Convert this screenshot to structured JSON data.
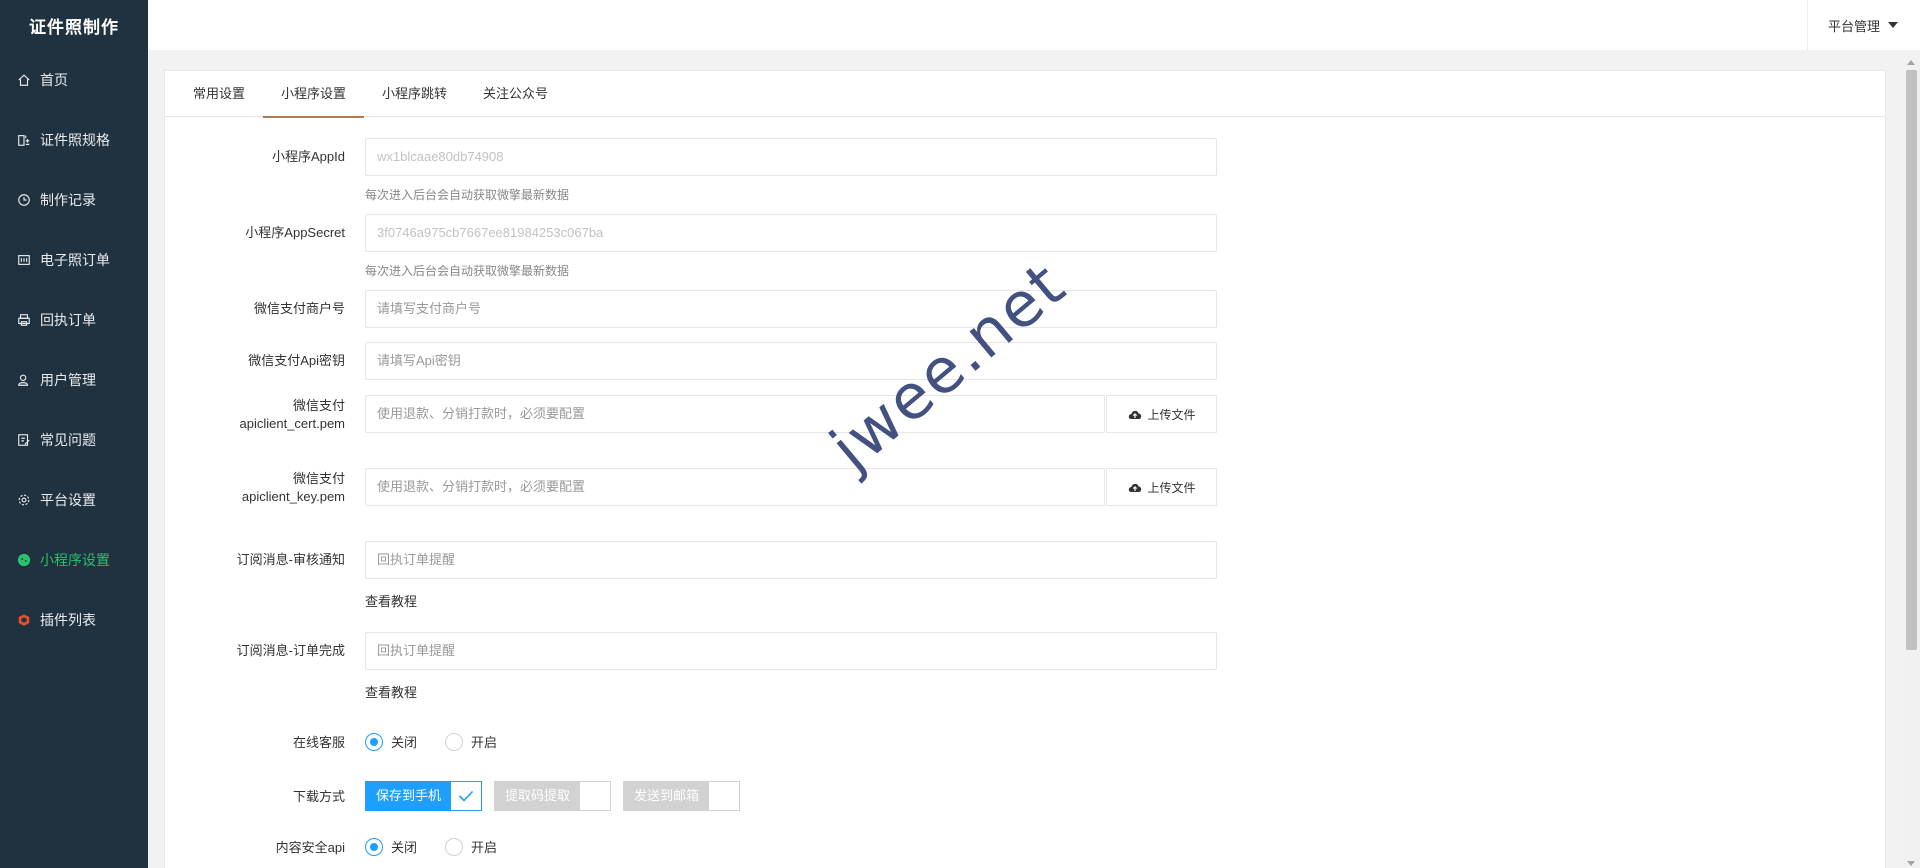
{
  "app": {
    "title": "证件照制作"
  },
  "sidebar": {
    "items": [
      {
        "label": "首页",
        "icon": "home-icon"
      },
      {
        "label": "证件照规格",
        "icon": "spec-icon"
      },
      {
        "label": "制作记录",
        "icon": "clock-icon"
      },
      {
        "label": "电子照订单",
        "icon": "grid-icon"
      },
      {
        "label": "回执订单",
        "icon": "printer-icon"
      },
      {
        "label": "用户管理",
        "icon": "user-icon"
      },
      {
        "label": "常见问题",
        "icon": "edit-icon"
      },
      {
        "label": "平台设置",
        "icon": "gear-icon"
      },
      {
        "label": "小程序设置",
        "icon": "wechat-icon",
        "active": true
      },
      {
        "label": "插件列表",
        "icon": "plugin-icon"
      }
    ],
    "active_color": "#2ac06d"
  },
  "header": {
    "platform_menu": "平台管理"
  },
  "tabs": [
    {
      "label": "常用设置"
    },
    {
      "label": "小程序设置",
      "active": true
    },
    {
      "label": "小程序跳转"
    },
    {
      "label": "关注公众号"
    }
  ],
  "form": {
    "appid": {
      "label": "小程序AppId",
      "value": "wx1blcaae80db74908",
      "hint": "每次进入后台会自动获取微擎最新数据"
    },
    "appsecret": {
      "label": "小程序AppSecret",
      "value": "3f0746a975cb7667ee81984253c067ba",
      "hint": "每次进入后台会自动获取微擎最新数据"
    },
    "mch_id": {
      "label": "微信支付商户号",
      "placeholder": "请填写支付商户号"
    },
    "api_key": {
      "label": "微信支付Api密钥",
      "placeholder": "请填写Api密钥"
    },
    "cert": {
      "label_line1": "微信支付",
      "label_line2": "apiclient_cert.pem",
      "placeholder": "使用退款、分销打款时，必须要配置",
      "button": "上传文件"
    },
    "key": {
      "label_line1": "微信支付",
      "label_line2": "apiclient_key.pem",
      "placeholder": "使用退款、分销打款时，必须要配置",
      "button": "上传文件"
    },
    "sub_audit": {
      "label": "订阅消息-审核通知",
      "placeholder": "回执订单提醒",
      "link": "查看教程"
    },
    "sub_done": {
      "label": "订阅消息-订单完成",
      "placeholder": "回执订单提醒",
      "link": "查看教程"
    },
    "online_service": {
      "label": "在线客服",
      "options": [
        "关闭",
        "开启"
      ],
      "selected": "关闭"
    },
    "download": {
      "label": "下载方式",
      "options": [
        {
          "label": "保存到手机",
          "checked": true
        },
        {
          "label": "提取码提取",
          "checked": false
        },
        {
          "label": "发送到邮箱",
          "checked": false
        }
      ]
    },
    "content_security": {
      "label": "内容安全api",
      "options": [
        "关闭",
        "开启"
      ],
      "selected": "关闭"
    }
  },
  "watermark": "jwee.net",
  "accent_color": "#1e9fff"
}
